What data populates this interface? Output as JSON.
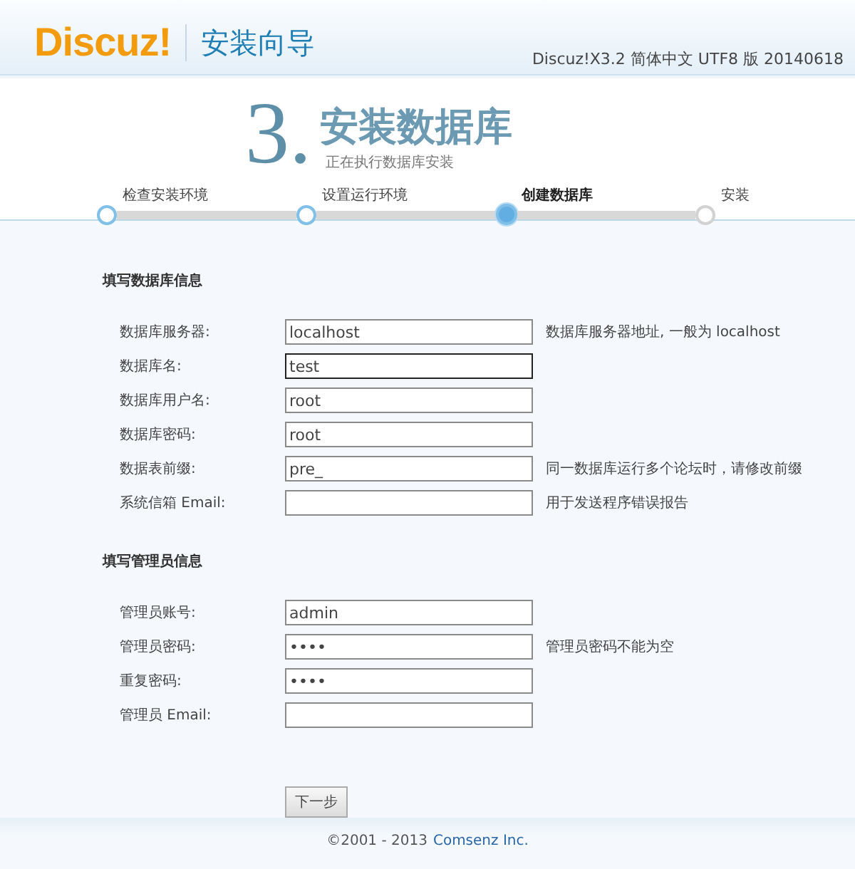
{
  "header": {
    "logo": "Discuz!",
    "title": "安装向导",
    "version": "Discuz!X3.2 简体中文 UTF8 版 20140618"
  },
  "step": {
    "number": "3.",
    "title": "安装数据库",
    "subtitle": "正在执行数据库安装"
  },
  "steps": [
    {
      "label": "检查安装环境",
      "done": true,
      "selected": false
    },
    {
      "label": "设置运行环境",
      "done": true,
      "selected": false
    },
    {
      "label": "创建数据库",
      "done": false,
      "selected": true
    },
    {
      "label": "安装",
      "done": false,
      "selected": false
    }
  ],
  "sections": [
    {
      "title": "填写数据库信息",
      "fields": [
        {
          "label": "数据库服务器:",
          "value": "localhost",
          "focused": false,
          "hint": "数据库服务器地址, 一般为 localhost"
        },
        {
          "label": "数据库名:",
          "value": "test",
          "focused": true
        },
        {
          "label": "数据库用户名:",
          "value": "root",
          "focused": false
        },
        {
          "label": "数据库密码:",
          "value": "root",
          "focused": false
        },
        {
          "label": "数据表前缀:",
          "value": "pre_",
          "focused": false,
          "hint": "同一数据库运行多个论坛时，请修改前缀"
        },
        {
          "label": "系统信箱 Email:",
          "focused": false,
          "hint": "用于发送程序错误报告"
        }
      ]
    },
    {
      "title": "填写管理员信息",
      "fields": [
        {
          "label": "管理员账号:",
          "value": "admin",
          "focused": false
        },
        {
          "label": "管理员密码:",
          "value": "••••",
          "focused": false,
          "hint": "管理员密码不能为空"
        },
        {
          "label": "重复密码:",
          "value": "••••",
          "focused": false
        },
        {
          "label": "管理员 Email:",
          "focused": false
        }
      ]
    }
  ],
  "submit": "下一步",
  "footer": {
    "text": "©2001 - 2013",
    "link": "Comsenz Inc."
  }
}
